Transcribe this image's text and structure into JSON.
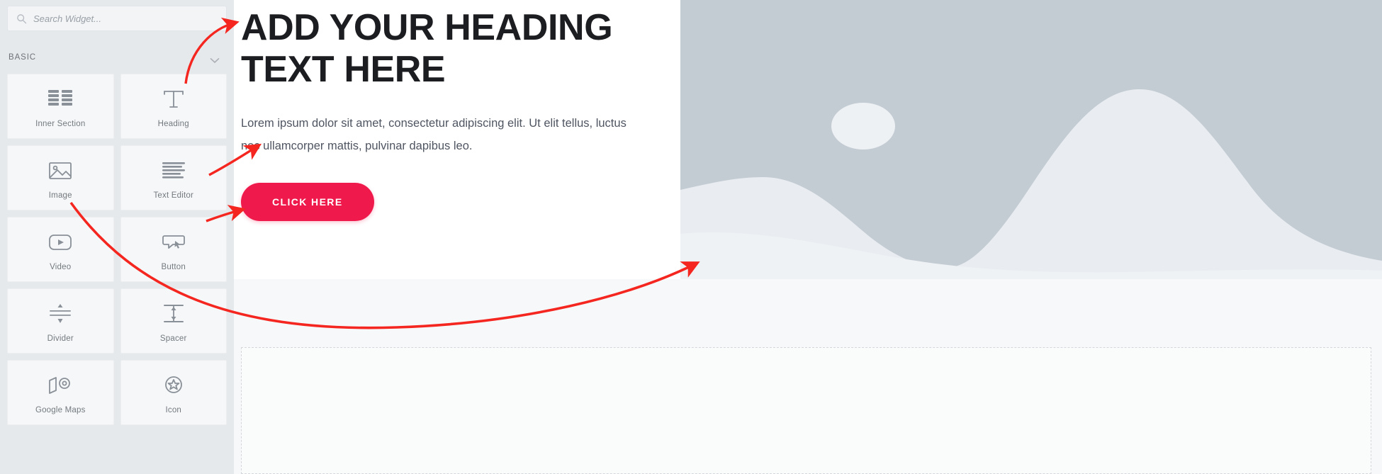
{
  "sidebar": {
    "search": {
      "placeholder": "Search Widget...",
      "value": "",
      "icon": "search-icon"
    },
    "section": {
      "title": "BASIC",
      "collapse_icon": "chevron-down-icon"
    },
    "widgets": [
      {
        "label": "Inner Section",
        "icon": "inner-section-icon"
      },
      {
        "label": "Heading",
        "icon": "heading-icon"
      },
      {
        "label": "Image",
        "icon": "image-icon"
      },
      {
        "label": "Text Editor",
        "icon": "text-editor-icon"
      },
      {
        "label": "Video",
        "icon": "video-icon"
      },
      {
        "label": "Button",
        "icon": "button-icon"
      },
      {
        "label": "Divider",
        "icon": "divider-icon"
      },
      {
        "label": "Spacer",
        "icon": "spacer-icon"
      },
      {
        "label": "Google Maps",
        "icon": "map-pin-icon"
      },
      {
        "label": "Icon",
        "icon": "icon-star-icon"
      }
    ]
  },
  "canvas": {
    "hero": {
      "heading": "ADD YOUR HEADING TEXT HERE",
      "paragraph": "Lorem ipsum dolor sit amet, consectetur adipiscing elit. Ut elit tellus, luctus nec ullamcorper mattis, pulvinar dapibus leo.",
      "cta_label": "CLICK HERE",
      "image_placeholder": "landscape-placeholder-image"
    },
    "drop_zone": "drag-widget-here-dashed-area"
  },
  "annotations": {
    "color": "#f4261f",
    "arrows": [
      {
        "name": "arrow-to-heading",
        "target": "hero-heading"
      },
      {
        "name": "arrow-to-paragraph",
        "target": "hero-paragraph"
      },
      {
        "name": "arrow-to-button",
        "target": "hero-cta-button"
      },
      {
        "name": "arrow-to-image",
        "target": "hero-image"
      }
    ]
  },
  "colors": {
    "sidebar_bg": "#e6e9ec",
    "widget_bg": "#f6f7f8",
    "cta": "#f0194c",
    "heading": "#1c1d20",
    "body_text": "#4f5561",
    "image_sky": "#c3cbd3",
    "image_hills": "#e9edf1",
    "annotation_red": "#f4261f"
  }
}
